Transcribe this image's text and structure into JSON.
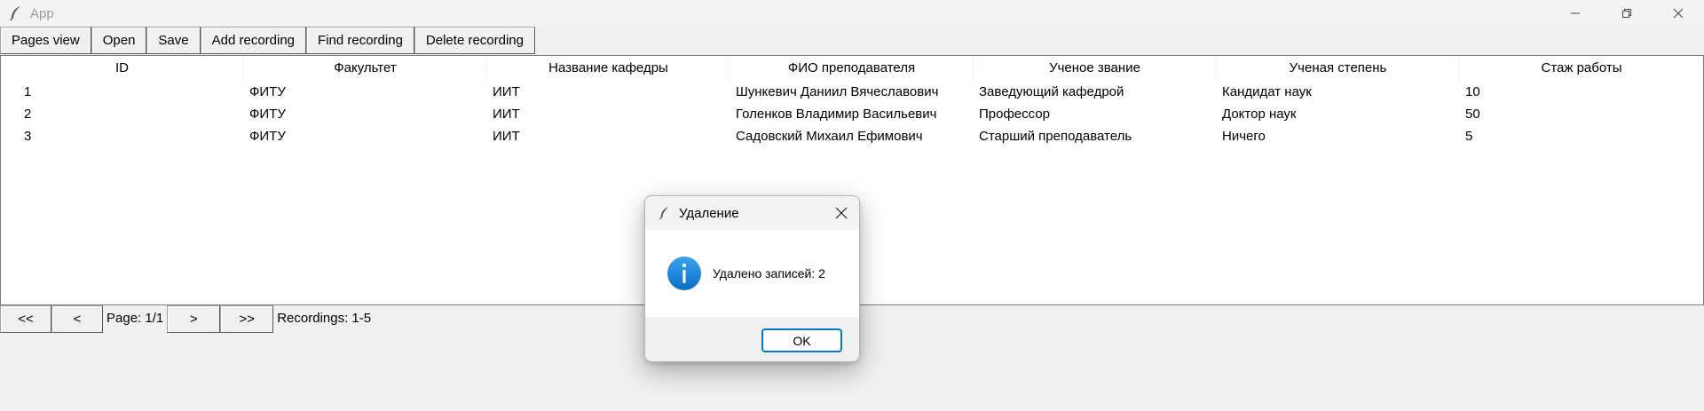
{
  "window": {
    "title": "App",
    "icon": "feather-icon",
    "controls": [
      "minimize-icon",
      "restore-icon",
      "close-icon"
    ]
  },
  "toolbar": {
    "buttons": [
      "Pages view",
      "Open",
      "Save",
      "Add recording",
      "Find recording",
      "Delete recording"
    ]
  },
  "table": {
    "columns": [
      "ID",
      "Факультет",
      "Название кафедры",
      "ФИО преподавателя",
      "Ученое звание",
      "Ученая степень",
      "Стаж работы"
    ],
    "rows": [
      [
        "1",
        "ФИТУ",
        "ИИТ",
        "Шункевич Даниил Вячеславович",
        "Заведующий кафедрой",
        "Кандидат наук",
        "10"
      ],
      [
        "2",
        "ФИТУ",
        "ИИТ",
        "Голенков Владимир Васильевич",
        "Профессор",
        "Доктор наук",
        "50"
      ],
      [
        "3",
        "ФИТУ",
        "ИИТ",
        "Садовский Михаил Ефимович",
        "Старший преподаватель",
        "Ничего",
        "5"
      ]
    ]
  },
  "pager": {
    "first": "<<",
    "prev": "<",
    "page_label": "Page: 1/1",
    "next": ">",
    "last": ">>",
    "recordings_label": "Recordings: 1-5"
  },
  "dialog": {
    "title": "Удаление",
    "icon": "info-icon",
    "message": "Удалено записей: 2",
    "ok_label": "OK",
    "accent_color": "#0078d4"
  }
}
